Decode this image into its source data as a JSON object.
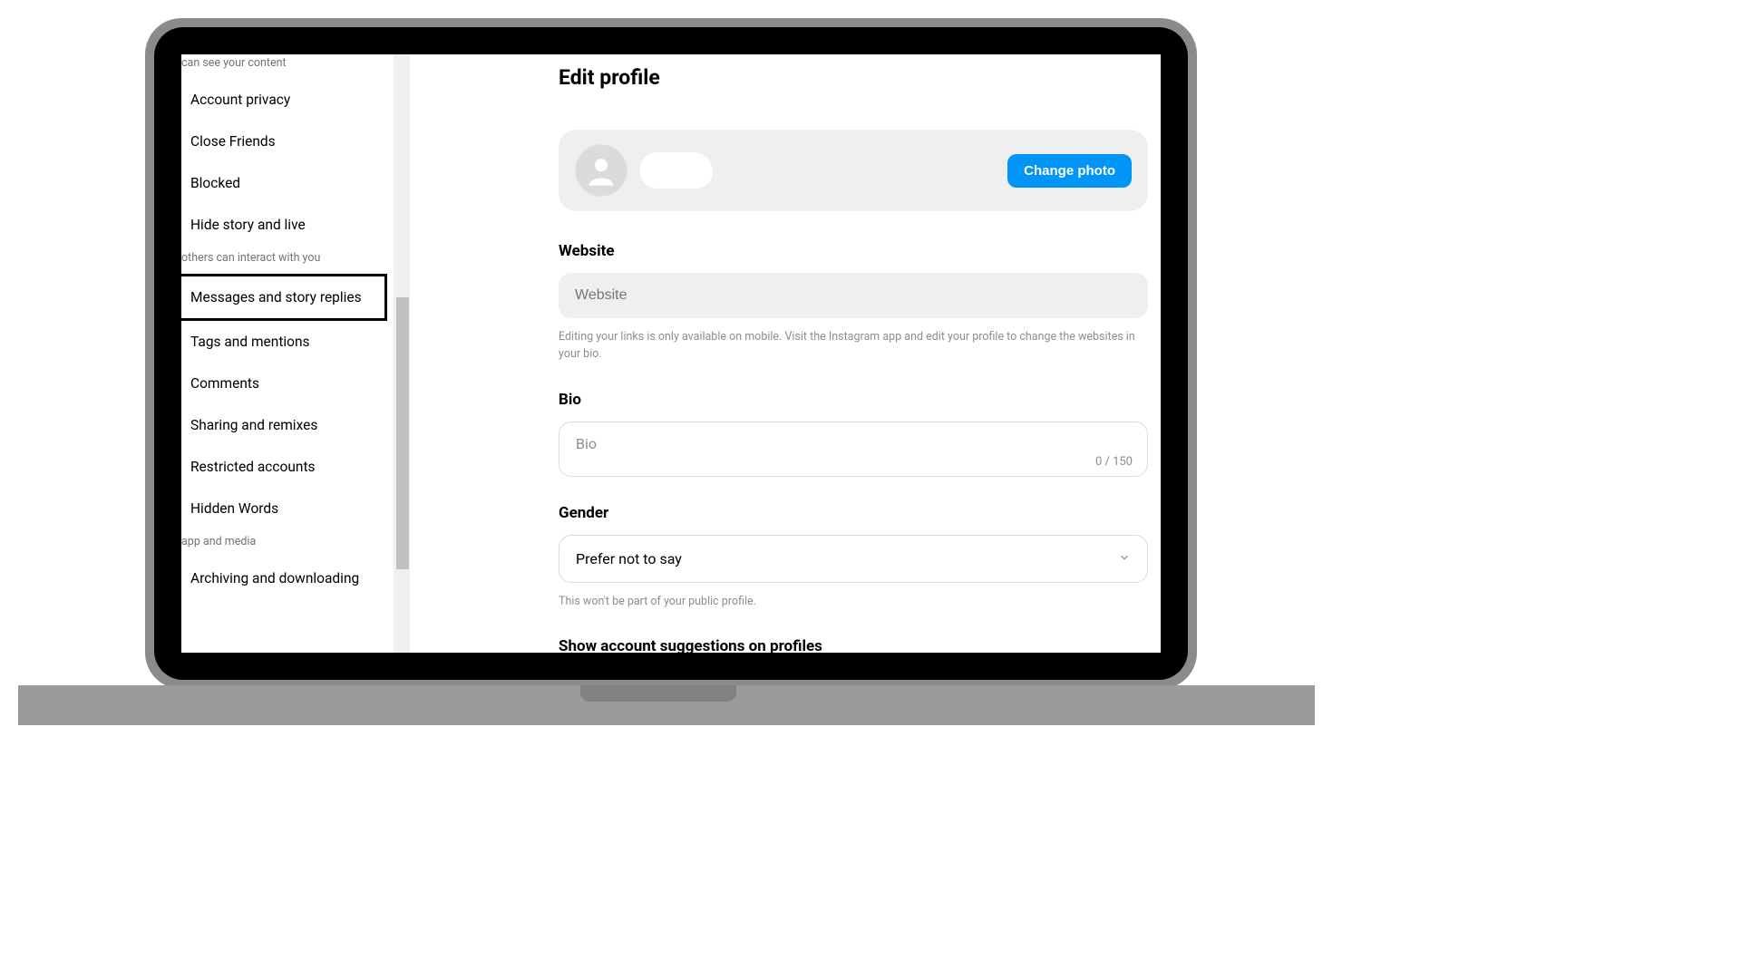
{
  "sidebar": {
    "section1": {
      "header": "can see your content"
    },
    "items1": [
      {
        "label": "Account privacy"
      },
      {
        "label": "Close Friends"
      },
      {
        "label": "Blocked"
      },
      {
        "label": "Hide story and live"
      }
    ],
    "section2": {
      "header": "others can interact with you"
    },
    "items2": [
      {
        "label": "Messages and story replies"
      },
      {
        "label": "Tags and mentions"
      },
      {
        "label": "Comments"
      },
      {
        "label": "Sharing and remixes"
      },
      {
        "label": "Restricted accounts"
      },
      {
        "label": "Hidden Words"
      }
    ],
    "section3": {
      "header": "app and media"
    },
    "items3": [
      {
        "label": "Archiving and downloading"
      }
    ]
  },
  "main": {
    "title": "Edit profile",
    "change_photo": "Change photo",
    "website": {
      "label": "Website",
      "placeholder": "Website",
      "helper": "Editing your links is only available on mobile. Visit the Instagram app and edit your profile to change the websites in your bio."
    },
    "bio": {
      "label": "Bio",
      "placeholder": "Bio",
      "counter": "0 / 150"
    },
    "gender": {
      "label": "Gender",
      "value": "Prefer not to say",
      "helper": "This won't be part of your public profile."
    },
    "suggestions_label": "Show account suggestions on profiles"
  }
}
